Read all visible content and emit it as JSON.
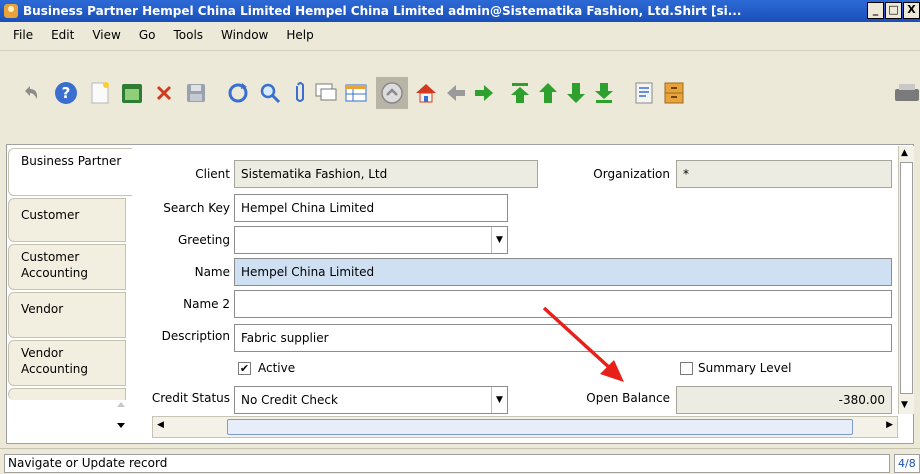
{
  "window": {
    "title": "Business Partner  Hempel China Limited  Hempel China Limited  admin@Sistematika Fashion, Ltd.Shirt [si...",
    "minimize": "_",
    "maximize": "□",
    "close": "X"
  },
  "menu": {
    "file_label": "File",
    "edit_label": "Edit",
    "view_label": "View",
    "go_label": "Go",
    "tools_label": "Tools",
    "window_label": "Window",
    "help_label": "Help"
  },
  "toolbar": {
    "icons": [
      "undo-icon",
      "help-icon",
      "new-record-icon",
      "copy-record-icon",
      "delete-icon",
      "save-icon",
      "refresh-icon",
      "find-icon",
      "attachment-icon",
      "chat-icon",
      "grid-toggle-icon",
      "history-icon",
      "home-icon",
      "previous-icon",
      "next-icon",
      "first-record-icon",
      "previous-record-icon",
      "next-record-icon",
      "last-record-icon",
      "report-icon",
      "archive-icon",
      "print-icon"
    ],
    "colors": {
      "green": "#2da02d",
      "red": "#d23a20",
      "blue": "#3a6fd0",
      "gray": "#7a7a7a"
    }
  },
  "tabs": {
    "business_partner": "Business Partner",
    "customer": "Customer",
    "customer_accounting": "Customer Accounting",
    "vendor": "Vendor",
    "vendor_accounting": "Vendor Accounting"
  },
  "form": {
    "client": {
      "label": "Client",
      "value": "Sistematika Fashion, Ltd"
    },
    "organization": {
      "label": "Organization",
      "value": "*"
    },
    "search_key": {
      "label": "Search Key",
      "value": "Hempel China Limited"
    },
    "greeting": {
      "label": "Greeting",
      "value": ""
    },
    "name": {
      "label": "Name",
      "value": "Hempel China Limited"
    },
    "name2": {
      "label": "Name 2",
      "value": ""
    },
    "description": {
      "label": "Description",
      "value": "Fabric supplier"
    },
    "active": {
      "label": "Active",
      "checked": true
    },
    "summary_level": {
      "label": "Summary Level",
      "checked": false
    },
    "credit_status": {
      "label": "Credit Status",
      "value": "No Credit Check"
    },
    "open_balance": {
      "label": "Open Balance",
      "value": "-380.00"
    }
  },
  "status": {
    "message": "Navigate or Update record",
    "record_count": "4/8"
  },
  "annotation": {
    "arrow_color": "#e8201a"
  }
}
